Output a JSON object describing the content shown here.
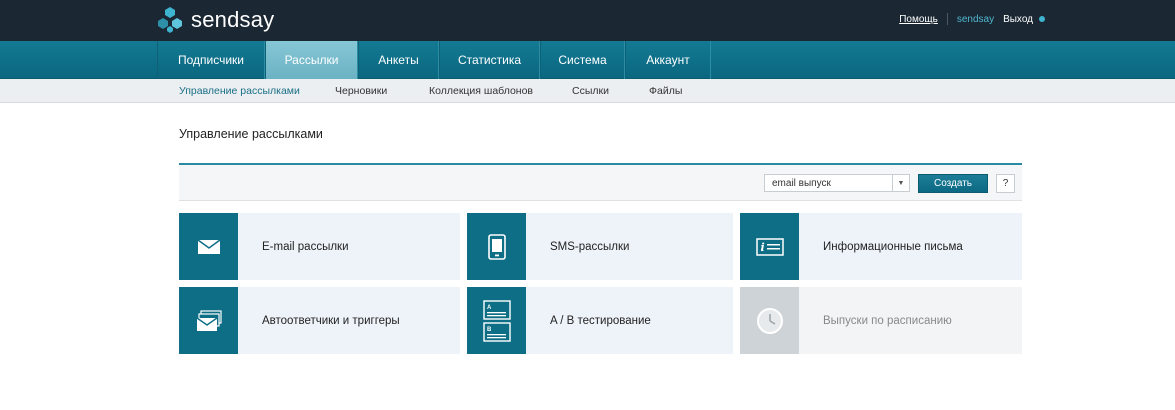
{
  "app": {
    "logo_text": "sendsay"
  },
  "header": {
    "help": "Помощь",
    "user": "sendsay",
    "logout": "Выход"
  },
  "main_nav": {
    "tabs": [
      {
        "label": "Подписчики"
      },
      {
        "label": "Рассылки",
        "active": true
      },
      {
        "label": "Анкеты"
      },
      {
        "label": "Статистика"
      },
      {
        "label": "Система"
      },
      {
        "label": "Аккаунт"
      }
    ]
  },
  "sub_nav": {
    "items": [
      {
        "label": "Управление рассылками",
        "active": true
      },
      {
        "label": "Черновики"
      },
      {
        "label": "Коллекция шаблонов"
      },
      {
        "label": "Ссылки"
      },
      {
        "label": "Файлы"
      }
    ]
  },
  "page": {
    "title": "Управление рассылками"
  },
  "toolbar": {
    "type_select_value": "email выпуск",
    "create_label": "Создать",
    "help_label": "?"
  },
  "cards": [
    {
      "label": "E-mail рассылки",
      "icon": "envelope-icon"
    },
    {
      "label": "SMS-рассылки",
      "icon": "phone-icon"
    },
    {
      "label": "Информационные письма",
      "icon": "info-letter-icon"
    },
    {
      "label": "Автоответчики и триггеры",
      "icon": "stacked-envelopes-icon"
    },
    {
      "label": "A / B тестирование",
      "icon": "ab-test-icon"
    },
    {
      "label": "Выпуски по расписанию",
      "icon": "clock-icon",
      "disabled": true
    }
  ],
  "colors": {
    "topbar": "#1b2733",
    "nav": "#0b6780",
    "nav_active": "#6bb2c4",
    "card_icon": "#0d6e86",
    "card_bg": "#eef3fa",
    "accent_link": "#4fb7cf"
  }
}
